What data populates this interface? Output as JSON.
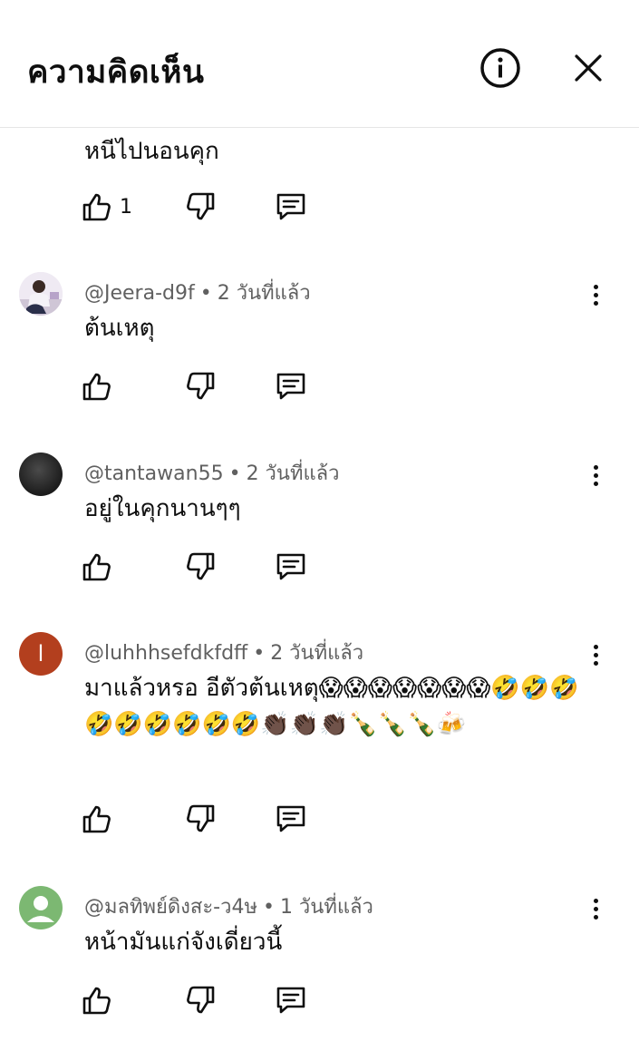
{
  "header": {
    "title": "ความคิดเห็น",
    "info_icon": "info-icon",
    "close_icon": "close-icon"
  },
  "partial_comment": {
    "text": "หนีไปนอนคุก",
    "like_count": "1"
  },
  "comments": [
    {
      "author": "@Jeera-d9f",
      "time": "2 วันที่แล้ว",
      "text": "ต้นเหตุ",
      "avatar": "photo"
    },
    {
      "author": "@tantawan55",
      "time": "2 วันที่แล้ว",
      "text": "อยู่ในคุกนานๆๆ",
      "avatar": "dark-circle"
    },
    {
      "author": "@luhhhsefdkfdff",
      "time": "2 วันที่แล้ว",
      "text": "มาแล้วหรอ อีตัวต้นเหตุ😱😱😱😱😱😱😱🤣🤣🤣🤣🤣🤣🤣🤣🤣👏🏿👏🏿👏🏿🍾🍾🍾🍻",
      "avatar_letter": "l",
      "avatar_color": "#b33f1e"
    },
    {
      "author": "@มลทิพย์ดิงสะ-ว4ษ",
      "time": "1 วันที่แล้ว",
      "text": "หน้ามันแก่จังเดี่ยวนี้",
      "avatar_color": "#7cb872"
    }
  ],
  "separator": "•",
  "colors": {
    "accent_orange": "#b33f1e",
    "avatar_green": "#7cb872",
    "meta_gray": "#606060"
  }
}
